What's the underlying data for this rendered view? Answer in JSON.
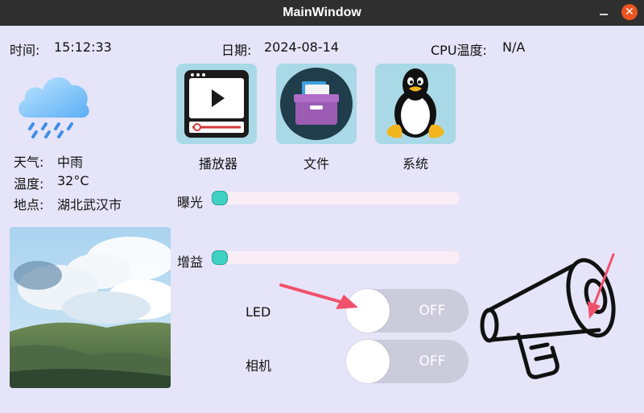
{
  "window": {
    "title": "MainWindow"
  },
  "status": {
    "time_label": "时间:",
    "time_value": "15:12:33",
    "date_label": "日期:",
    "date_value": "2024-08-14",
    "cpu_label": "CPU温度:",
    "cpu_value": "N/A"
  },
  "weather": {
    "icon": "rain-cloud-icon",
    "condition_label": "天气:",
    "condition_value": "中雨",
    "temperature_label": "温度:",
    "temperature_value": "32°C",
    "location_label": "地点:",
    "location_value": "湖北武汉市"
  },
  "apps": [
    {
      "label": "播放器",
      "icon": "video-player-icon"
    },
    {
      "label": "文件",
      "icon": "file-box-icon"
    },
    {
      "label": "系统",
      "icon": "linux-penguin-icon"
    }
  ],
  "sliders": [
    {
      "label": "曝光",
      "value": 0
    },
    {
      "label": "增益",
      "value": 0
    }
  ],
  "toggles": [
    {
      "label": "LED",
      "state": "OFF"
    },
    {
      "label": "相机",
      "state": "OFF"
    }
  ],
  "colors": {
    "background": "#e6e4f8",
    "titlebar": "#2f2f2f",
    "close": "#e95420",
    "slider_track": "#fbedf5",
    "slider_handle": "#3fd2c2",
    "toggle_off": "#cbcbdc",
    "app_tile": "#a9d9e6",
    "arrow": "#f1506a"
  }
}
